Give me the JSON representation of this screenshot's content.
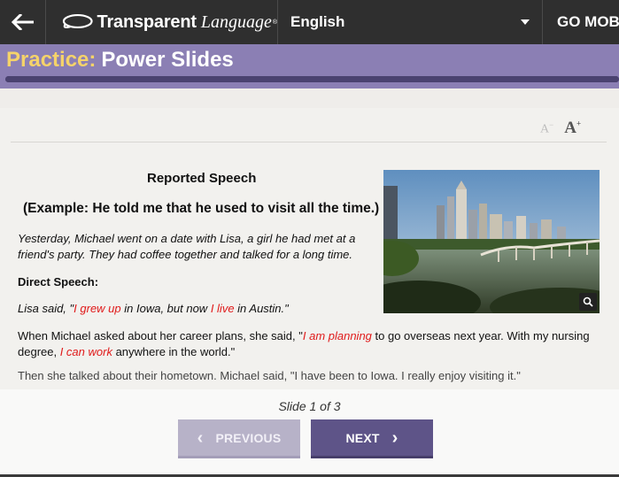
{
  "header": {
    "brand_name": "Transparent",
    "brand_lang": "Language",
    "brand_reg": "®",
    "language": "English",
    "go_mobile": "GO MOBILE"
  },
  "practice": {
    "prefix": "Practice:",
    "name": "Power Slides",
    "progress": 1.0
  },
  "font_tools": {
    "decrease": "A",
    "decrease_sup": "−",
    "increase": "A",
    "increase_sup": "+"
  },
  "slide": {
    "heading": "Reported Speech",
    "subheading": "(Example: He told me that he used to visit all the time.)",
    "p1": "Yesterday, Michael went on a date with Lisa, a girl he had met at a friend's party. They had coffee together and talked for a long time.",
    "p2": "Direct Speech:",
    "p3": {
      "a": "Lisa said, \"",
      "b": "I grew up",
      "c": " in Iowa, but now ",
      "d": "I live",
      "e": " in Austin.\""
    },
    "p4": {
      "a": "When Michael asked about her career plans, she said, \"",
      "b": "I am planning",
      "c": " to go overseas next year. With my nursing degree, ",
      "d": "I can work",
      "e": " anywhere in the world.\""
    },
    "p5": "Then she talked about their hometown. Michael said, \"I have been to Iowa. I really enjoy visiting it.\""
  },
  "footer": {
    "counter": "Slide 1 of 3",
    "previous": "PREVIOUS",
    "next": "NEXT"
  },
  "colors": {
    "accent": "#8b7fb4",
    "button_next": "#5e5488",
    "button_prev": "#b7b2c8",
    "highlight_red": "#e01b1b",
    "title_prefix": "#f5d36a"
  },
  "icons": {
    "back": "arrow-left-icon",
    "logo": "speech-bubble-logo-icon",
    "dropdown": "caret-down-icon",
    "zoom": "magnifier-icon",
    "prev": "chevron-left-icon",
    "next": "chevron-right-icon"
  }
}
